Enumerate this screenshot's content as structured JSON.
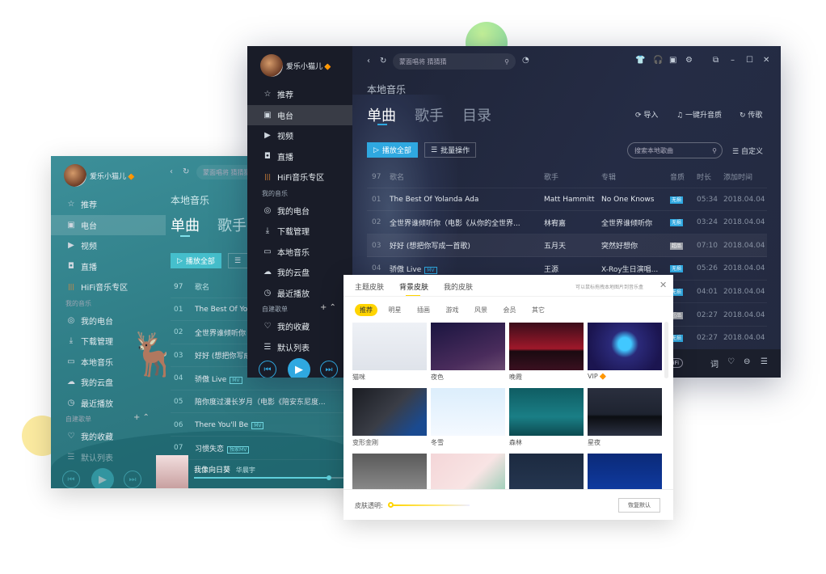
{
  "user": {
    "name": "爱乐小猫儿"
  },
  "sidebar": {
    "items": [
      {
        "label": "推荐",
        "icon": "star-icon"
      },
      {
        "label": "电台",
        "icon": "radio-icon",
        "active": true
      },
      {
        "label": "视频",
        "icon": "video-icon"
      },
      {
        "label": "直播",
        "icon": "live-icon"
      },
      {
        "label": "HiFi音乐专区",
        "icon": "hifi-icon"
      }
    ],
    "my_music_label": "我的音乐",
    "my_music": [
      {
        "label": "我的电台",
        "icon": "podcast-icon"
      },
      {
        "label": "下载管理",
        "icon": "download-icon"
      },
      {
        "label": "本地音乐",
        "icon": "monitor-icon"
      },
      {
        "label": "我的云盘",
        "icon": "cloud-icon"
      },
      {
        "label": "最近播放",
        "icon": "clock-icon"
      }
    ],
    "playlists_label": "自建歌单",
    "playlists": [
      {
        "label": "我的收藏",
        "icon": "heart-icon"
      },
      {
        "label": "默认列表",
        "icon": "list-icon"
      }
    ]
  },
  "topbar": {
    "search_placeholder": "蒙面唱将 猜猜猜"
  },
  "main": {
    "section_title": "本地音乐",
    "tabs": [
      "单曲",
      "歌手",
      "目录"
    ],
    "actions": [
      "导入",
      "一键升音质",
      "传歌"
    ],
    "play_all": "播放全部",
    "batch": "批量操作",
    "local_search_placeholder": "搜索本地歌曲",
    "customize": "自定义",
    "columns": {
      "count": "97",
      "name": "歌名",
      "artist": "歌手",
      "album": "专辑",
      "quality": "音质",
      "duration": "时长",
      "added": "添加时间"
    },
    "songs": [
      {
        "no": "01",
        "name": "The Best Of Yolanda Ada",
        "artist": "Matt Hammitt",
        "album": "No One Knows",
        "quality": "无损",
        "duration": "05:34",
        "added": "2018.04.04"
      },
      {
        "no": "02",
        "name": "全世界谁倾听你（电影《从你的全世界...",
        "artist": "林宥嘉",
        "album": "全世界谁倾听你",
        "quality": "无损",
        "duration": "03:24",
        "added": "2018.04.04"
      },
      {
        "no": "03",
        "name": "好好 (想把你写成一首歌)",
        "artist": "五月天",
        "album": "突然好想你",
        "quality": "超品",
        "duration": "07:10",
        "added": "2018.04.04"
      },
      {
        "no": "04",
        "name": "骄傲 Live",
        "mv": "MV",
        "artist": "王源",
        "album": "X-Roy生日演唱...",
        "quality": "无损",
        "duration": "05:26",
        "added": "2018.04.04"
      },
      {
        "no": "05",
        "quality": "无损",
        "duration": "04:01",
        "added": "2018.04.04"
      },
      {
        "no": "06",
        "quality": "超品",
        "duration": "02:27",
        "added": "2018.04.04"
      },
      {
        "no": "07",
        "quality": "无损",
        "duration": "02:27",
        "added": "2018.04.04"
      }
    ],
    "hifi_badge": "HiFi"
  },
  "teal": {
    "songs": [
      {
        "no": "01",
        "name": "The Best Of Yo"
      },
      {
        "no": "02",
        "name": "全世界谁倾听你"
      },
      {
        "no": "03",
        "name": "好好 (想把你写成"
      },
      {
        "no": "04",
        "name": "骄傲 Live",
        "mv": "MV"
      },
      {
        "no": "05",
        "name": "陪你度过漫长岁月（电影《陪安东尼度..."
      },
      {
        "no": "06",
        "name": "There You'll Be",
        "mv": "MV"
      },
      {
        "no": "07",
        "name": "习惯失恋",
        "mv": "独家MV"
      }
    ],
    "now_playing": {
      "title": "我像向日葵",
      "artist": "华晨宇",
      "progress": 0.88
    }
  },
  "skin_panel": {
    "tabs": [
      "主题皮肤",
      "背景皮肤",
      "我的皮肤"
    ],
    "active_tab": 1,
    "hint": "可以鼠标拖拽本地图片到音乐盒",
    "categories": [
      "推荐",
      "明星",
      "插画",
      "游戏",
      "风景",
      "会员",
      "其它"
    ],
    "skins": [
      {
        "label": "猫咪",
        "bg": "linear-gradient(#eef1f6,#dfe3ea)"
      },
      {
        "label": "夜色",
        "bg": "linear-gradient(160deg,#1a1540,#4a2c5c 70%,#6a4a70)"
      },
      {
        "label": "晚霞",
        "bg": "linear-gradient(#3a0d1a,#a0182a 55%,#1a0a10 60%,#3a1020)"
      },
      {
        "label": "VIP",
        "vip": true,
        "bg": "radial-gradient(circle at 50% 45%,#41c8ff 0 14%,#2b2a7a 30%,#1b1550 80%)"
      },
      {
        "label": "变形金刚",
        "bg": "linear-gradient(135deg,#1a1c22,#3a3d46 50%,#1a4a90 85%)"
      },
      {
        "label": "冬雪",
        "bg": "linear-gradient(#dceefc,#f4f9ff)"
      },
      {
        "label": "森林",
        "bg": "linear-gradient(#0f5c62,#1a7f86 60%,#0c4a50)"
      },
      {
        "label": "星夜",
        "bg": "linear-gradient(#2a2f3e,#1e2330 55%,#0b0d12 60%,#2b3142)"
      },
      {
        "label": "",
        "bg": "linear-gradient(#5a5a5a,#8a8a8a)"
      },
      {
        "label": "",
        "bg": "linear-gradient(135deg,#f4d6d8,#f8e4e4 60%,#9fcfb9)"
      },
      {
        "label": "",
        "bg": "linear-gradient(#1c2a40,#253650)"
      },
      {
        "label": "",
        "bg": "linear-gradient(#0b2a78,#0f3aa0)"
      }
    ],
    "opacity_label": "皮肤透明:",
    "opacity": 0.0,
    "reset": "恢复默认"
  },
  "colors": {
    "accent": "#2fa8e0",
    "skin_accent": "#ffd400",
    "teal": "#2f7d86"
  }
}
